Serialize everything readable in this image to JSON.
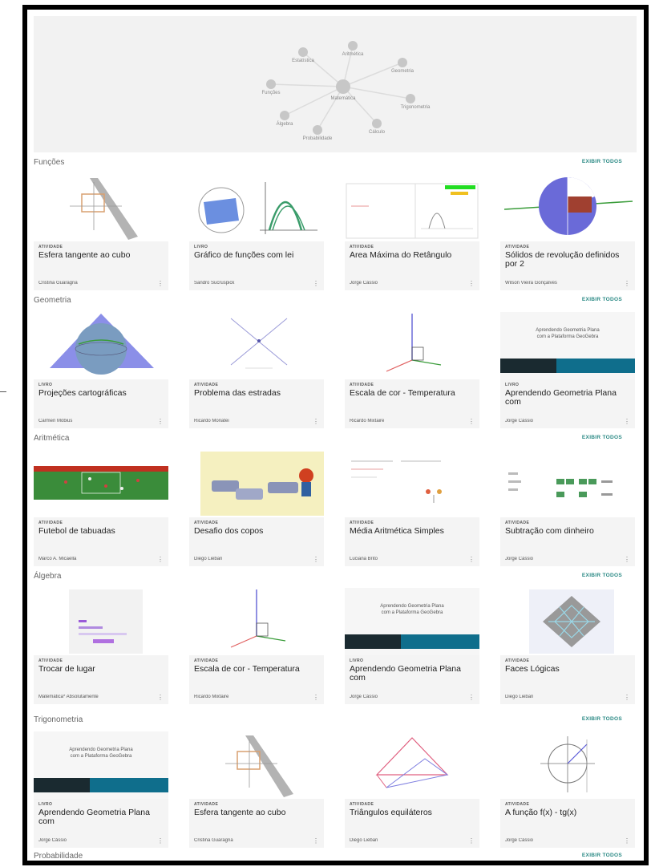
{
  "topic_map": {
    "center": "Matemática",
    "nodes": [
      "Aritmética",
      "Geometria",
      "Trigonometria",
      "Cálculo",
      "Probabilidade",
      "Álgebra",
      "Funções",
      "Estatística"
    ]
  },
  "sections": [
    {
      "title": "Funções",
      "see_all": "EXIBIR TODOS",
      "cards": [
        {
          "type": "ATIVIDADE",
          "title": "Esfera tangente ao cubo",
          "author": "Cristina Guaragna",
          "menu": "⋮"
        },
        {
          "type": "LIVRO",
          "title": "Gráfico de funções com lei",
          "author": "Sandro Sucruspick",
          "menu": "⋮"
        },
        {
          "type": "ATIVIDADE",
          "title": "Área Máxima do Retângulo",
          "author": "Jorge Cássio",
          "menu": "⋮"
        },
        {
          "type": "ATIVIDADE",
          "title": "Sólidos de revolução definidos por 2",
          "author": "Wilson Vieira Gonçalves",
          "menu": "⋮"
        }
      ]
    },
    {
      "title": "Geometria",
      "see_all": "EXIBIR TODOS",
      "cards": [
        {
          "type": "LIVRO",
          "title": "Projeções cartográficas",
          "author": "Carmen Möbius",
          "menu": "⋮"
        },
        {
          "type": "ATIVIDADE",
          "title": "Problema das estradas",
          "author": "Ricardo Moriatei",
          "menu": "⋮"
        },
        {
          "type": "ATIVIDADE",
          "title": "Escala de cor - Temperatura",
          "author": "Ricardo Mixtaire",
          "menu": "⋮"
        },
        {
          "type": "LIVRO",
          "title": "Aprendendo Geometria Plana com",
          "author": "Jorge Cássio",
          "menu": "⋮"
        }
      ]
    },
    {
      "title": "Aritmética",
      "see_all": "EXIBIR TODOS",
      "cards": [
        {
          "type": "ATIVIDADE",
          "title": "Futebol de tabuadas",
          "author": "Marco A. Micaella",
          "menu": "⋮"
        },
        {
          "type": "ATIVIDADE",
          "title": "Desafio dos copos",
          "author": "Diego Lieban",
          "menu": "⋮"
        },
        {
          "type": "ATIVIDADE",
          "title": "Média Aritmética Simples",
          "author": "Luciana Brito",
          "menu": "⋮"
        },
        {
          "type": "ATIVIDADE",
          "title": "Subtração com dinheiro",
          "author": "Jorge Cássio",
          "menu": "⋮"
        }
      ]
    },
    {
      "title": "Álgebra",
      "see_all": "EXIBIR TODOS",
      "cards": [
        {
          "type": "ATIVIDADE",
          "title": "Trocar de lugar",
          "author": "Matemática* Absolutamente",
          "menu": "⋮"
        },
        {
          "type": "ATIVIDADE",
          "title": "Escala de cor - Temperatura",
          "author": "Ricardo Mixtaire",
          "menu": "⋮"
        },
        {
          "type": "LIVRO",
          "title": "Aprendendo Geometria Plana com",
          "author": "Jorge Cássio",
          "menu": "⋮"
        },
        {
          "type": "ATIVIDADE",
          "title": "Faces Lógicas",
          "author": "Diego Lieban",
          "menu": "⋮"
        }
      ]
    },
    {
      "title": "Trigonometria",
      "see_all": "EXIBIR TODOS",
      "cards": [
        {
          "type": "LIVRO",
          "title": "Aprendendo Geometria Plana com",
          "author": "Jorge Cássio",
          "menu": "⋮"
        },
        {
          "type": "ATIVIDADE",
          "title": "Esfera tangente ao cubo",
          "author": "Cristina Guaragna",
          "menu": "⋮"
        },
        {
          "type": "ATIVIDADE",
          "title": "Triângulos equiláteros",
          "author": "Diego Lieban",
          "menu": "⋮"
        },
        {
          "type": "ATIVIDADE",
          "title": "A função f(x) - tg(x)",
          "author": "Jorge Cássio",
          "menu": "⋮"
        }
      ]
    },
    {
      "title": "Probabilidade",
      "see_all": "EXIBIR TODOS",
      "cards": []
    }
  ],
  "book_cover_text": {
    "line1": "Aprendendo Geometria Plana",
    "line2": "com a Plataforma GeoGebra"
  }
}
